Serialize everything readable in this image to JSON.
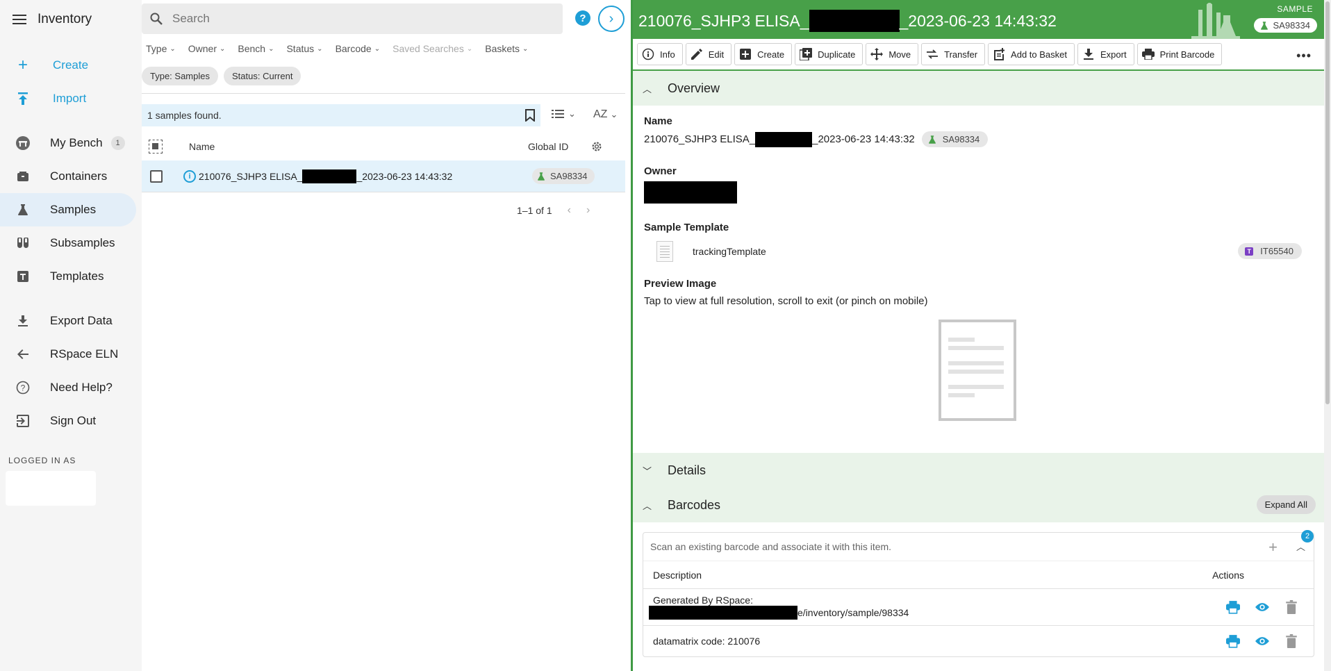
{
  "sidebar": {
    "title": "Inventory",
    "actions": [
      {
        "label": "Create",
        "icon": "plus-icon"
      },
      {
        "label": "Import",
        "icon": "upload-icon"
      }
    ],
    "items": [
      {
        "label": "My Bench",
        "icon": "bench-icon",
        "badge": "1"
      },
      {
        "label": "Containers",
        "icon": "box-icon"
      },
      {
        "label": "Samples",
        "icon": "flask-icon",
        "active": true
      },
      {
        "label": "Subsamples",
        "icon": "test-tubes-icon"
      },
      {
        "label": "Templates",
        "icon": "template-icon"
      }
    ],
    "links": [
      {
        "label": "Export Data",
        "icon": "download-icon"
      },
      {
        "label": "RSpace ELN",
        "icon": "arrow-left-icon"
      },
      {
        "label": "Need Help?",
        "icon": "help-icon"
      },
      {
        "label": "Sign Out",
        "icon": "sign-out-icon"
      }
    ],
    "logged_in_label": "LOGGED IN AS"
  },
  "search": {
    "placeholder": "Search",
    "filters": [
      "Type",
      "Owner",
      "Bench",
      "Status",
      "Barcode",
      "Saved Searches",
      "Baskets"
    ],
    "chips": [
      "Type: Samples",
      "Status: Current"
    ],
    "results_text": "1 samples found.",
    "sort_label": "AZ",
    "columns": {
      "name": "Name",
      "global_id": "Global ID"
    },
    "rows": [
      {
        "name_prefix": "210076_SJHP3 ELISA_",
        "name_suffix": "_2023-06-23 14:43:32",
        "global_id": "SA98334"
      }
    ],
    "pagination": "1–1 of 1"
  },
  "record": {
    "title_prefix": "210076_SJHP3 ELISA_",
    "title_suffix": "_2023-06-23 14:43:32",
    "type_label": "SAMPLE",
    "global_id": "SA98334",
    "toolbar": [
      "Info",
      "Edit",
      "Create",
      "Duplicate",
      "Move",
      "Transfer",
      "Add to Basket",
      "Export",
      "Print Barcode"
    ],
    "overview": {
      "heading": "Overview",
      "name_label": "Name",
      "name_prefix": "210076_SJHP3 ELISA_",
      "name_suffix": "_2023-06-23 14:43:32",
      "owner_label": "Owner",
      "template_label": "Sample Template",
      "template_name": "trackingTemplate",
      "template_gid": "IT65540",
      "template_badge": "T",
      "preview_label": "Preview Image",
      "preview_hint": "Tap to view at full resolution, scroll to exit (or pinch on mobile)"
    },
    "details_heading": "Details",
    "barcodes": {
      "heading": "Barcodes",
      "expand_all": "Expand All",
      "scan_placeholder": "Scan an existing barcode and associate it with this item.",
      "count": "2",
      "col_description": "Description",
      "col_actions": "Actions",
      "rows": [
        {
          "line1": "Generated By RSpace:",
          "line2_suffix": "e/inventory/sample/98334"
        },
        {
          "line1": "datamatrix code: 210076"
        }
      ]
    }
  },
  "colors": {
    "accent": "#1e9ed6",
    "header_green": "#48a049",
    "section_bg": "#e9f3e9",
    "selected_row": "#e3f2fb"
  }
}
